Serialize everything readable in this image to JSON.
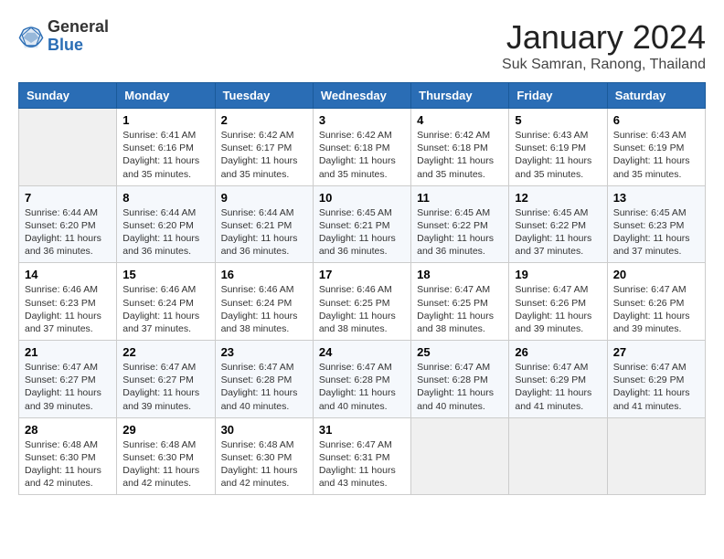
{
  "header": {
    "logo_general": "General",
    "logo_blue": "Blue",
    "month_title": "January 2024",
    "location": "Suk Samran, Ranong, Thailand"
  },
  "days_of_week": [
    "Sunday",
    "Monday",
    "Tuesday",
    "Wednesday",
    "Thursday",
    "Friday",
    "Saturday"
  ],
  "weeks": [
    [
      {
        "num": "",
        "detail": ""
      },
      {
        "num": "1",
        "detail": "Sunrise: 6:41 AM\nSunset: 6:16 PM\nDaylight: 11 hours\nand 35 minutes."
      },
      {
        "num": "2",
        "detail": "Sunrise: 6:42 AM\nSunset: 6:17 PM\nDaylight: 11 hours\nand 35 minutes."
      },
      {
        "num": "3",
        "detail": "Sunrise: 6:42 AM\nSunset: 6:18 PM\nDaylight: 11 hours\nand 35 minutes."
      },
      {
        "num": "4",
        "detail": "Sunrise: 6:42 AM\nSunset: 6:18 PM\nDaylight: 11 hours\nand 35 minutes."
      },
      {
        "num": "5",
        "detail": "Sunrise: 6:43 AM\nSunset: 6:19 PM\nDaylight: 11 hours\nand 35 minutes."
      },
      {
        "num": "6",
        "detail": "Sunrise: 6:43 AM\nSunset: 6:19 PM\nDaylight: 11 hours\nand 35 minutes."
      }
    ],
    [
      {
        "num": "7",
        "detail": "Sunrise: 6:44 AM\nSunset: 6:20 PM\nDaylight: 11 hours\nand 36 minutes."
      },
      {
        "num": "8",
        "detail": "Sunrise: 6:44 AM\nSunset: 6:20 PM\nDaylight: 11 hours\nand 36 minutes."
      },
      {
        "num": "9",
        "detail": "Sunrise: 6:44 AM\nSunset: 6:21 PM\nDaylight: 11 hours\nand 36 minutes."
      },
      {
        "num": "10",
        "detail": "Sunrise: 6:45 AM\nSunset: 6:21 PM\nDaylight: 11 hours\nand 36 minutes."
      },
      {
        "num": "11",
        "detail": "Sunrise: 6:45 AM\nSunset: 6:22 PM\nDaylight: 11 hours\nand 36 minutes."
      },
      {
        "num": "12",
        "detail": "Sunrise: 6:45 AM\nSunset: 6:22 PM\nDaylight: 11 hours\nand 37 minutes."
      },
      {
        "num": "13",
        "detail": "Sunrise: 6:45 AM\nSunset: 6:23 PM\nDaylight: 11 hours\nand 37 minutes."
      }
    ],
    [
      {
        "num": "14",
        "detail": "Sunrise: 6:46 AM\nSunset: 6:23 PM\nDaylight: 11 hours\nand 37 minutes."
      },
      {
        "num": "15",
        "detail": "Sunrise: 6:46 AM\nSunset: 6:24 PM\nDaylight: 11 hours\nand 37 minutes."
      },
      {
        "num": "16",
        "detail": "Sunrise: 6:46 AM\nSunset: 6:24 PM\nDaylight: 11 hours\nand 38 minutes."
      },
      {
        "num": "17",
        "detail": "Sunrise: 6:46 AM\nSunset: 6:25 PM\nDaylight: 11 hours\nand 38 minutes."
      },
      {
        "num": "18",
        "detail": "Sunrise: 6:47 AM\nSunset: 6:25 PM\nDaylight: 11 hours\nand 38 minutes."
      },
      {
        "num": "19",
        "detail": "Sunrise: 6:47 AM\nSunset: 6:26 PM\nDaylight: 11 hours\nand 39 minutes."
      },
      {
        "num": "20",
        "detail": "Sunrise: 6:47 AM\nSunset: 6:26 PM\nDaylight: 11 hours\nand 39 minutes."
      }
    ],
    [
      {
        "num": "21",
        "detail": "Sunrise: 6:47 AM\nSunset: 6:27 PM\nDaylight: 11 hours\nand 39 minutes."
      },
      {
        "num": "22",
        "detail": "Sunrise: 6:47 AM\nSunset: 6:27 PM\nDaylight: 11 hours\nand 39 minutes."
      },
      {
        "num": "23",
        "detail": "Sunrise: 6:47 AM\nSunset: 6:28 PM\nDaylight: 11 hours\nand 40 minutes."
      },
      {
        "num": "24",
        "detail": "Sunrise: 6:47 AM\nSunset: 6:28 PM\nDaylight: 11 hours\nand 40 minutes."
      },
      {
        "num": "25",
        "detail": "Sunrise: 6:47 AM\nSunset: 6:28 PM\nDaylight: 11 hours\nand 40 minutes."
      },
      {
        "num": "26",
        "detail": "Sunrise: 6:47 AM\nSunset: 6:29 PM\nDaylight: 11 hours\nand 41 minutes."
      },
      {
        "num": "27",
        "detail": "Sunrise: 6:47 AM\nSunset: 6:29 PM\nDaylight: 11 hours\nand 41 minutes."
      }
    ],
    [
      {
        "num": "28",
        "detail": "Sunrise: 6:48 AM\nSunset: 6:30 PM\nDaylight: 11 hours\nand 42 minutes."
      },
      {
        "num": "29",
        "detail": "Sunrise: 6:48 AM\nSunset: 6:30 PM\nDaylight: 11 hours\nand 42 minutes."
      },
      {
        "num": "30",
        "detail": "Sunrise: 6:48 AM\nSunset: 6:30 PM\nDaylight: 11 hours\nand 42 minutes."
      },
      {
        "num": "31",
        "detail": "Sunrise: 6:47 AM\nSunset: 6:31 PM\nDaylight: 11 hours\nand 43 minutes."
      },
      {
        "num": "",
        "detail": ""
      },
      {
        "num": "",
        "detail": ""
      },
      {
        "num": "",
        "detail": ""
      }
    ]
  ]
}
